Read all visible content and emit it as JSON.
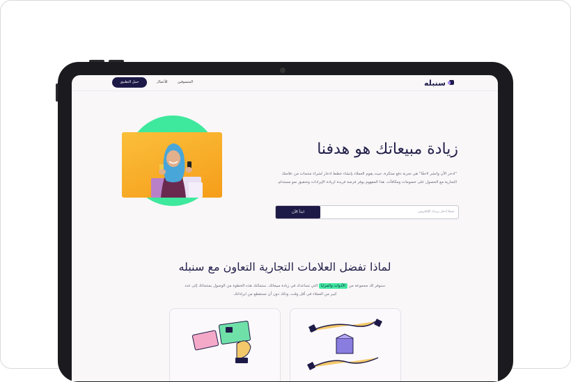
{
  "nav": {
    "logo": "سنبله",
    "links": [
      "المتسوقين",
      "للأعمال"
    ],
    "download_button": "حمل التطبيق"
  },
  "hero": {
    "title": "زيادة مبيعاتك هو هدفنا",
    "description": "\"ادخر الآن وانشر لاحقًا\" هي تجربة دفع مبتكرة، حيث يقوم العملاء بإنشاء خطط ادخار لشراء منتجات من علامتك التجارية مع الحصول على خصومات ومكافآت. هذا المفهوم يوفر فرصة فريدة لزيادة الإيرادات وتحقيق نمو مستدام.",
    "email_placeholder": "فضلا أدخل بريدك الإلكتروني",
    "start_button": "ابدأ الآن"
  },
  "why": {
    "title": "لماذا تفضل العلامات التجارية التعاون مع سنبله",
    "desc_before": "سنوفر لك مجموعة من",
    "desc_highlight": "الأدوات والمزايا",
    "desc_after": "التي تساعدك في زيادة مبيعاتك. ستمكنك هذه الخطوة من الوصول بمنتجاتك إلى عدد كبير من العملاء في أقل وقت، وذلك دون أن تستقطع من ايراداتك."
  },
  "colors": {
    "primary": "#1e1a47",
    "accent": "#40eaa0",
    "hero_photo_bg": "#f9a825"
  }
}
